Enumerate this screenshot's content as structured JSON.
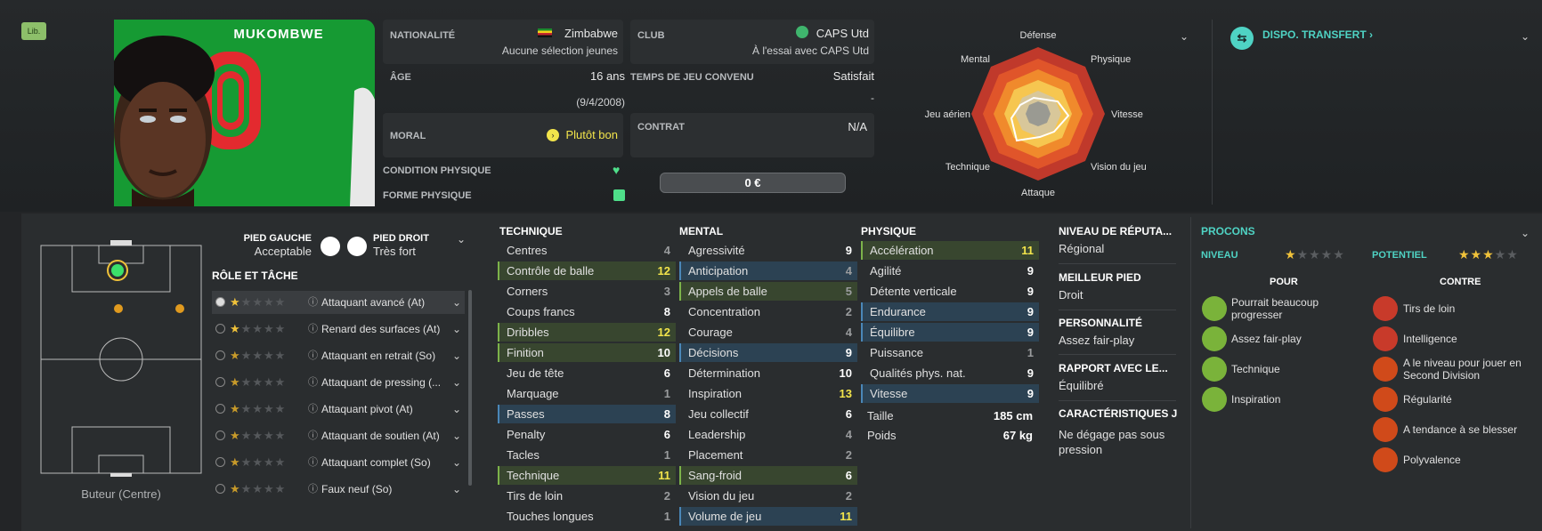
{
  "badge": "Lib.",
  "player": {
    "name": "MUKOMBWE",
    "shirt_number": "0"
  },
  "info": {
    "nationality_label": "NATIONALITÉ",
    "nationality": "Zimbabwe",
    "nationality_sub": "Aucune sélection jeunes",
    "club_label": "CLUB",
    "club": "CAPS Utd",
    "club_sub": "À l'essai avec CAPS Utd",
    "age_label": "ÂGE",
    "age": "16 ans",
    "dob": "(9/4/2008)",
    "playtime_label": "TEMPS DE JEU CONVENU",
    "playtime": "Satisfait",
    "playtime_sub": "-",
    "morale_label": "MORAL",
    "morale": "Plutôt bon",
    "contract_label": "CONTRAT",
    "contract": "N/A",
    "condition_label": "CONDITION PHYSIQUE",
    "form_label": "FORME PHYSIQUE",
    "value": "0 €"
  },
  "radar": {
    "labels": [
      "Défense",
      "Physique",
      "Vitesse",
      "Vision du jeu",
      "Attaque",
      "Technique",
      "Jeu aérien",
      "Mental"
    ]
  },
  "transfer": {
    "label": "DISPO. TRANSFERT ›"
  },
  "position": {
    "caption": "Buteur (Centre)"
  },
  "feet": {
    "left_label": "PIED GAUCHE",
    "left_val": "Acceptable",
    "right_label": "PIED DROIT",
    "right_val": "Très fort"
  },
  "roles": {
    "title": "RÔLE ET TÂCHE",
    "items": [
      {
        "name": "Attaquant avancé (At)",
        "stars": "★☆☆☆☆"
      },
      {
        "name": "Renard des surfaces (At)",
        "stars": "★☆☆☆☆"
      },
      {
        "name": "Attaquant en retrait (So)",
        "stars": "½☆☆☆☆"
      },
      {
        "name": "Attaquant de pressing (...",
        "stars": "½☆☆☆☆"
      },
      {
        "name": "Attaquant pivot (At)",
        "stars": "½☆☆☆☆"
      },
      {
        "name": "Attaquant de soutien (At)",
        "stars": "½☆☆☆☆"
      },
      {
        "name": "Attaquant complet (So)",
        "stars": "½☆☆☆☆"
      },
      {
        "name": "Faux neuf (So)",
        "stars": "½☆☆☆☆"
      }
    ]
  },
  "technique": {
    "title": "TECHNIQUE",
    "items": [
      {
        "n": "Centres",
        "v": "4"
      },
      {
        "n": "Contrôle de balle",
        "v": "12"
      },
      {
        "n": "Corners",
        "v": "3"
      },
      {
        "n": "Coups francs",
        "v": "8"
      },
      {
        "n": "Dribbles",
        "v": "12"
      },
      {
        "n": "Finition",
        "v": "10"
      },
      {
        "n": "Jeu de tête",
        "v": "6"
      },
      {
        "n": "Marquage",
        "v": "1"
      },
      {
        "n": "Passes",
        "v": "8"
      },
      {
        "n": "Penalty",
        "v": "6"
      },
      {
        "n": "Tacles",
        "v": "1"
      },
      {
        "n": "Technique",
        "v": "11"
      },
      {
        "n": "Tirs de loin",
        "v": "2"
      },
      {
        "n": "Touches longues",
        "v": "1"
      }
    ]
  },
  "mental": {
    "title": "MENTAL",
    "items": [
      {
        "n": "Agressivité",
        "v": "9"
      },
      {
        "n": "Anticipation",
        "v": "4"
      },
      {
        "n": "Appels de balle",
        "v": "5"
      },
      {
        "n": "Concentration",
        "v": "2"
      },
      {
        "n": "Courage",
        "v": "4"
      },
      {
        "n": "Décisions",
        "v": "9"
      },
      {
        "n": "Détermination",
        "v": "10"
      },
      {
        "n": "Inspiration",
        "v": "13"
      },
      {
        "n": "Jeu collectif",
        "v": "6"
      },
      {
        "n": "Leadership",
        "v": "4"
      },
      {
        "n": "Placement",
        "v": "2"
      },
      {
        "n": "Sang-froid",
        "v": "6"
      },
      {
        "n": "Vision du jeu",
        "v": "2"
      },
      {
        "n": "Volume de jeu",
        "v": "11"
      }
    ]
  },
  "physique": {
    "title": "PHYSIQUE",
    "items": [
      {
        "n": "Accélération",
        "v": "11"
      },
      {
        "n": "Agilité",
        "v": "9"
      },
      {
        "n": "Détente verticale",
        "v": "9"
      },
      {
        "n": "Endurance",
        "v": "9"
      },
      {
        "n": "Équilibre",
        "v": "9"
      },
      {
        "n": "Puissance",
        "v": "1"
      },
      {
        "n": "Qualités phys. nat.",
        "v": "9"
      },
      {
        "n": "Vitesse",
        "v": "9"
      }
    ],
    "height_label": "Taille",
    "height": "185 cm",
    "weight_label": "Poids",
    "weight": "67 kg"
  },
  "profile": {
    "rep_label": "NIVEAU DE RÉPUTA...",
    "rep": "Régional",
    "foot_label": "MEILLEUR PIED",
    "foot": "Droit",
    "pers_label": "PERSONNALITÉ",
    "pers": "Assez fair-play",
    "rel_label": "RAPPORT AVEC LE...",
    "rel": "Équilibré",
    "char_label": "CARACTÉRISTIQUES J",
    "char": "Ne dégage pas sous pression"
  },
  "procons": {
    "title": "PROCONS",
    "level_label": "NIVEAU",
    "potential_label": "POTENTIEL",
    "level_rating": 0.5,
    "potential_rating": 3.5,
    "pros_title": "POUR",
    "cons_title": "CONTRE",
    "pros": [
      "Pourrait beaucoup progresser",
      "Assez fair-play",
      "Technique",
      "Inspiration"
    ],
    "cons": [
      "Tirs de loin",
      "Intelligence",
      "A le niveau pour jouer en Second Division",
      "Régularité",
      "A tendance à se blesser",
      "Polyvalence"
    ]
  },
  "colors": {
    "accent": "#4fd3c4",
    "highlight_yellow": "#f2e44b",
    "green_row": "#3b4b35",
    "blue_row": "#2e4556"
  }
}
